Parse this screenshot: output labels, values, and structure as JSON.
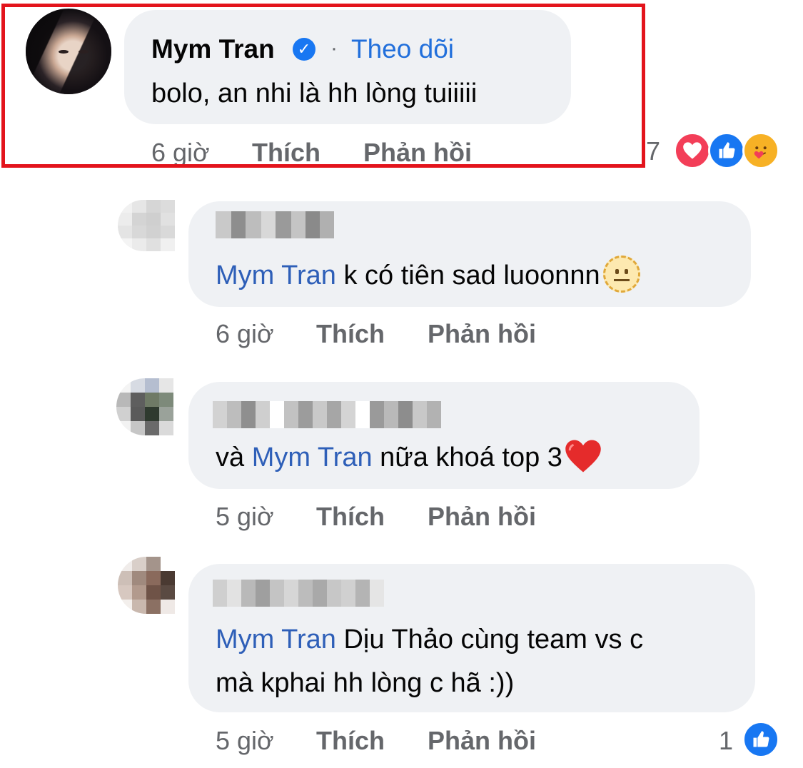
{
  "comments": [
    {
      "author": "Mym Tran",
      "verified": true,
      "separator": "·",
      "follow_label": "Theo dõi",
      "text": "bolo, an nhi là hh lòng tuiiiii",
      "time": "6 giờ",
      "like_label": "Thích",
      "reply_label": "Phản hồi",
      "reaction_count": "7",
      "reactions": [
        "love-icon",
        "like-icon",
        "care-icon"
      ]
    },
    {
      "author": "",
      "mention": "Mym Tran",
      "text": " k có tiên sad luoonnn",
      "emoji": "neutral-face-emoji",
      "time": "6 giờ",
      "like_label": "Thích",
      "reply_label": "Phản hồi"
    },
    {
      "author": "",
      "text_before": "và ",
      "mention": "Mym Tran",
      "text": " nữa khoá top 3",
      "emoji": "red-heart-emoji",
      "time": "5 giờ",
      "like_label": "Thích",
      "reply_label": "Phản hồi"
    },
    {
      "author": "",
      "mention": "Mym Tran",
      "text_line1": " Dịu Thảo cùng team vs c",
      "text_line2": "mà kphai hh lòng c hã :))",
      "time": "5 giờ",
      "like_label": "Thích",
      "reply_label": "Phản hồi",
      "reaction_count": "1",
      "reactions": [
        "like-icon"
      ]
    }
  ],
  "colors": {
    "highlight": "#e3141c",
    "bubble": "#eff1f4",
    "mention": "#2e5fb8",
    "follow": "#216fdb",
    "meta": "#65676b"
  }
}
